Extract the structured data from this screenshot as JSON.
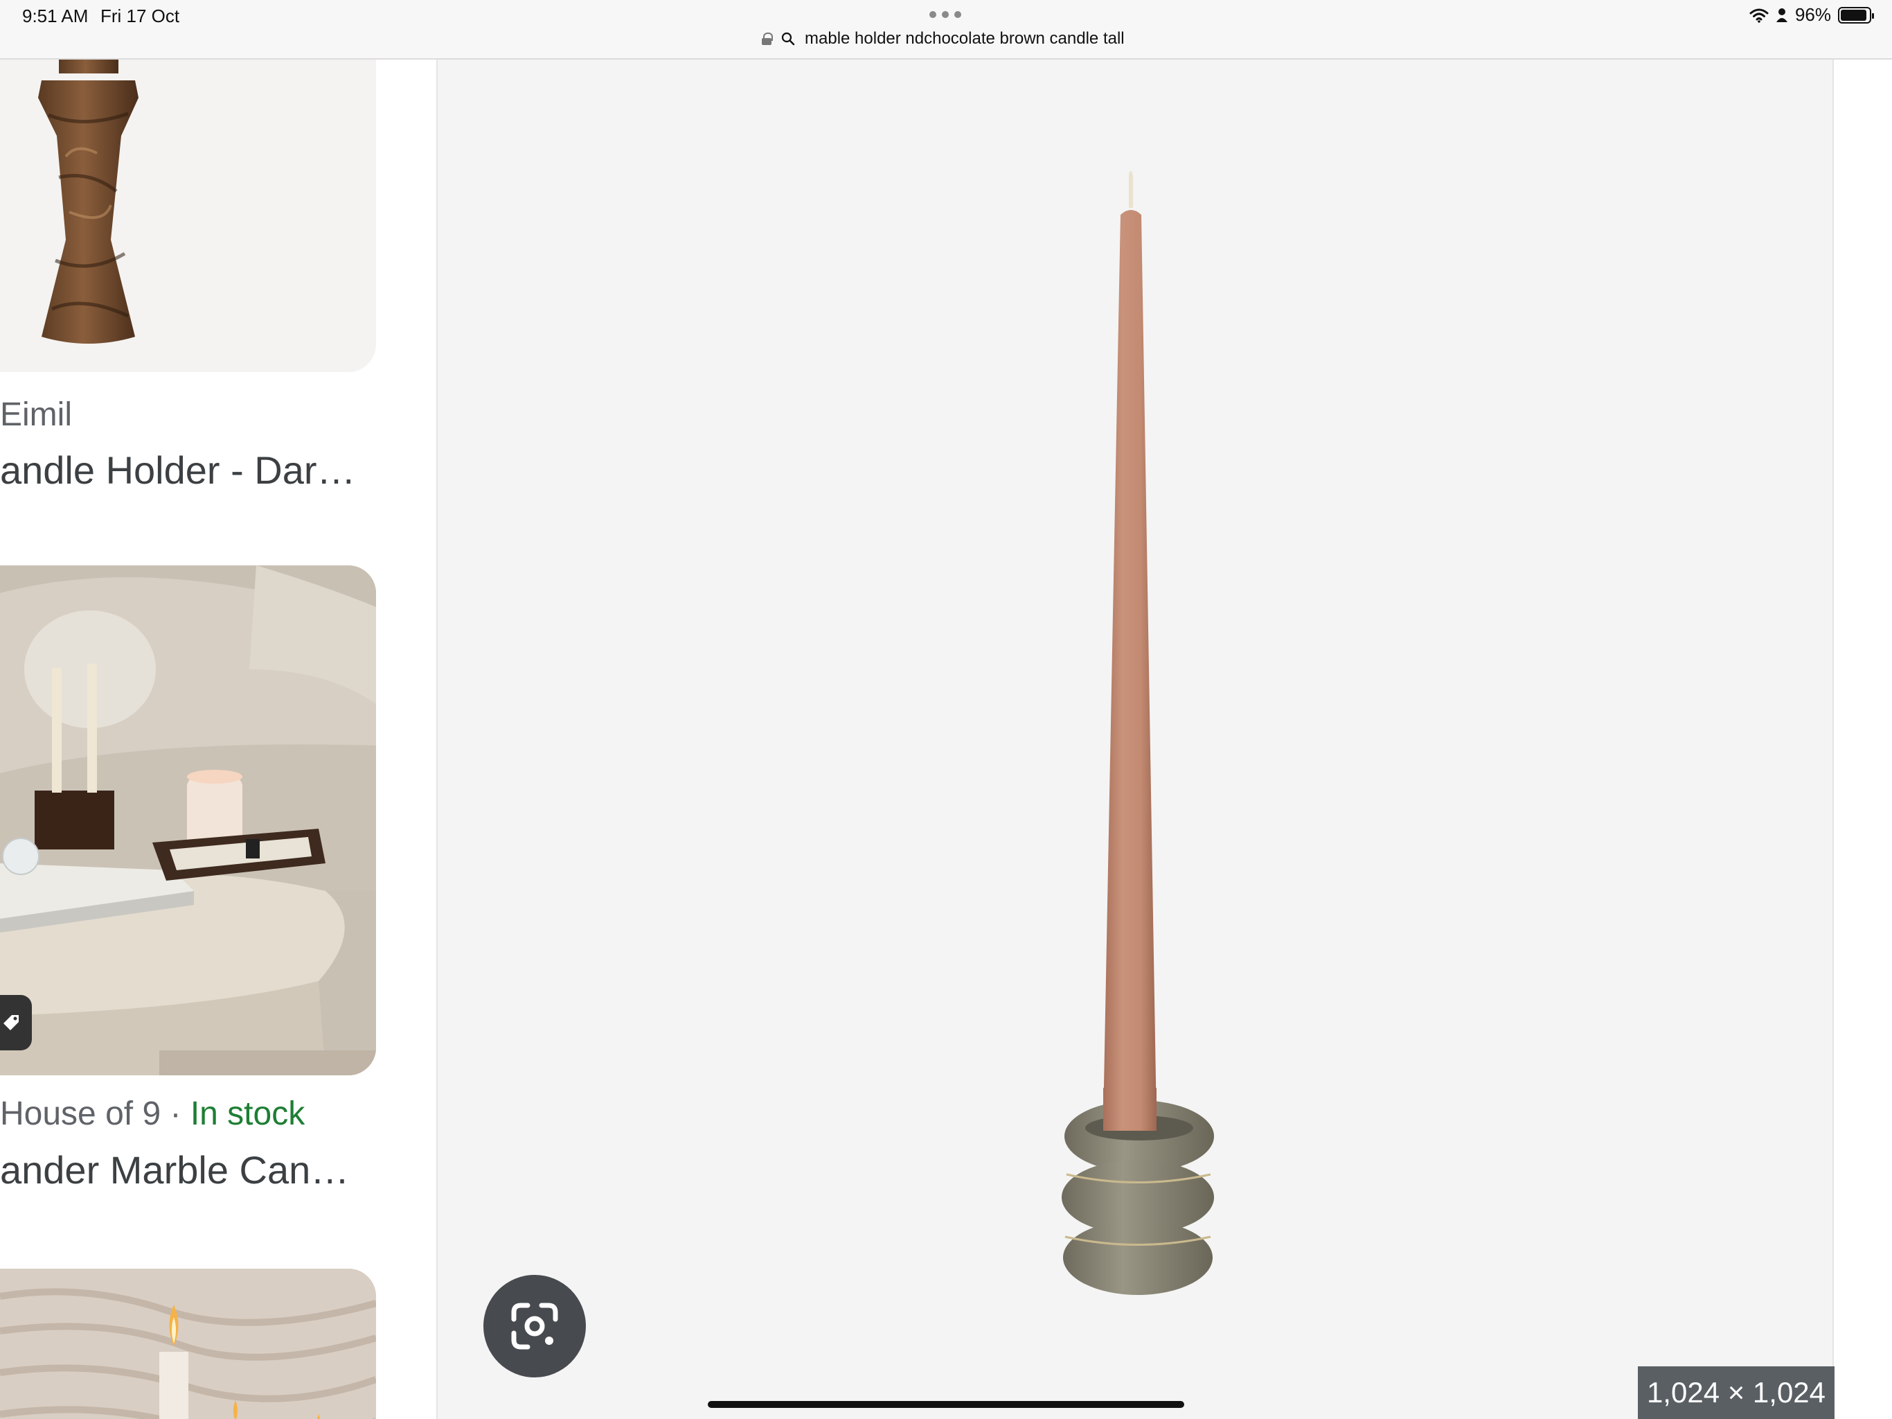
{
  "status_bar": {
    "time": "9:51 AM",
    "date": "Fri 17 Oct",
    "battery": "96%"
  },
  "url_bar": {
    "query": "mable holder ndchocolate brown candle tall"
  },
  "results": [
    {
      "source": "Eimil",
      "title": "andle Holder - Dar…"
    },
    {
      "source": "House of 9 · ",
      "stock": "In stock",
      "title": "ander Marble Can…"
    }
  ],
  "viewer": {
    "dimensions": "1,024 × 1,024"
  },
  "icons": {
    "wifi": "wifi-icon",
    "person": "person-icon",
    "battery": "battery-icon",
    "lock": "lock-icon",
    "search": "search-icon",
    "lens": "google-lens-icon",
    "tag": "tag-icon"
  },
  "colors": {
    "in_stock": "#1e7e34",
    "viewer_bg": "#f4f4f4",
    "candle": "#c08a72",
    "holder": "#8b8777"
  }
}
